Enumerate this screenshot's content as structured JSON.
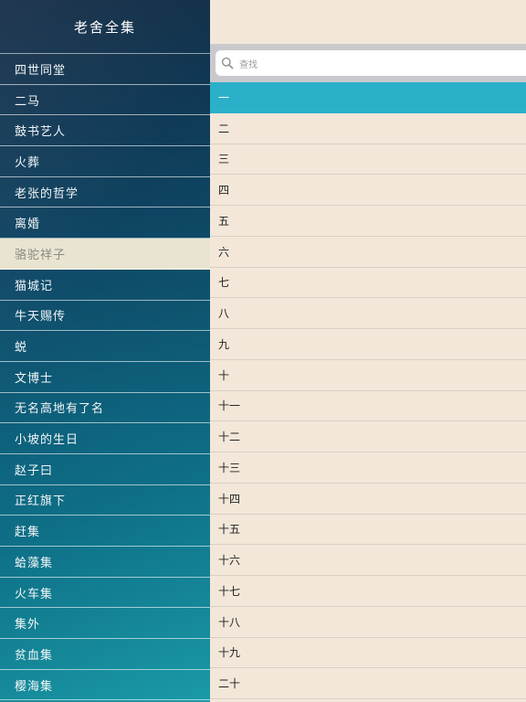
{
  "sidebar": {
    "title": "老舍全集",
    "selected_index": 6,
    "books": [
      "四世同堂",
      "二马",
      "鼓书艺人",
      "火葬",
      "老张的哲学",
      "离婚",
      "骆驼祥子",
      "猫城记",
      "牛天赐传",
      "蜕",
      "文博士",
      "无名高地有了名",
      "小坡的生日",
      "赵子曰",
      "正红旗下",
      "赶集",
      "蛤藻集",
      "火车集",
      "集外",
      "贫血集",
      "樱海集"
    ]
  },
  "search": {
    "placeholder": "查找"
  },
  "chapters": {
    "active_index": 0,
    "items": [
      "一",
      "二",
      "三",
      "四",
      "五",
      "六",
      "七",
      "八",
      "九",
      "十",
      "十一",
      "十二",
      "十三",
      "十四",
      "十五",
      "十六",
      "十七",
      "十八",
      "十九",
      "二十"
    ]
  },
  "colors": {
    "accent": "#2ab0c8",
    "background": "#f3e7d9",
    "selected_book": "#e9e4d2"
  }
}
